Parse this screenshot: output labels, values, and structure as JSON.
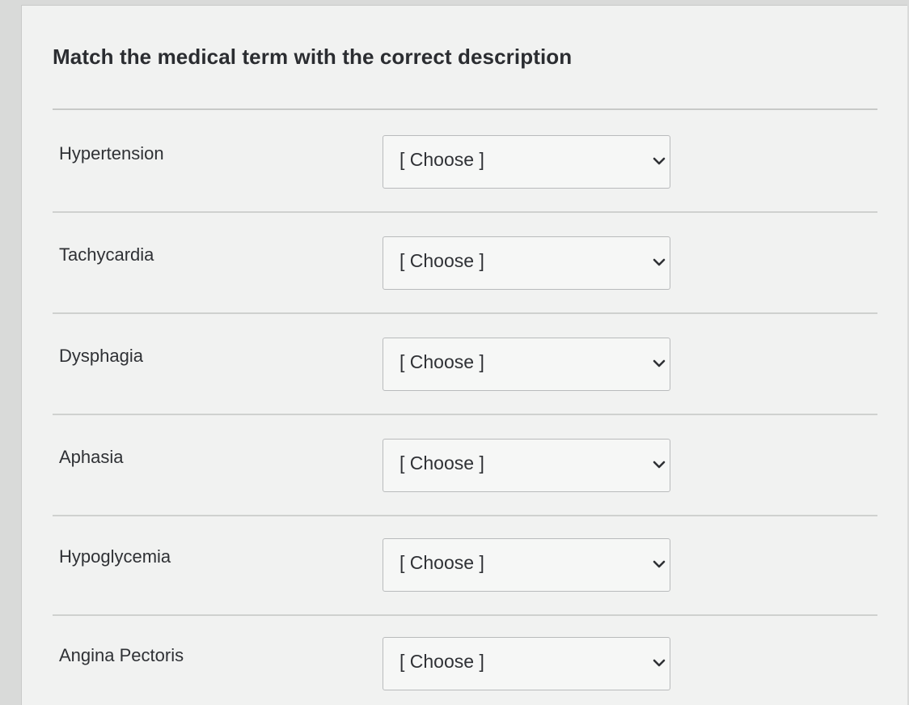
{
  "question": {
    "title": "Match the medical term with the correct description"
  },
  "rows": [
    {
      "term": "Hypertension",
      "selected": "[ Choose ]"
    },
    {
      "term": "Tachycardia",
      "selected": "[ Choose ]"
    },
    {
      "term": "Dysphagia",
      "selected": "[ Choose ]"
    },
    {
      "term": "Aphasia",
      "selected": "[ Choose ]"
    },
    {
      "term": "Hypoglycemia",
      "selected": "[ Choose ]"
    },
    {
      "term": "Angina Pectoris",
      "selected": "[ Choose ]"
    }
  ],
  "icons": {
    "dropdown": "chevron-down-icon"
  },
  "colors": {
    "background": "#f1f2f1",
    "text": "#2f3135",
    "border": "#b9bbbc"
  }
}
